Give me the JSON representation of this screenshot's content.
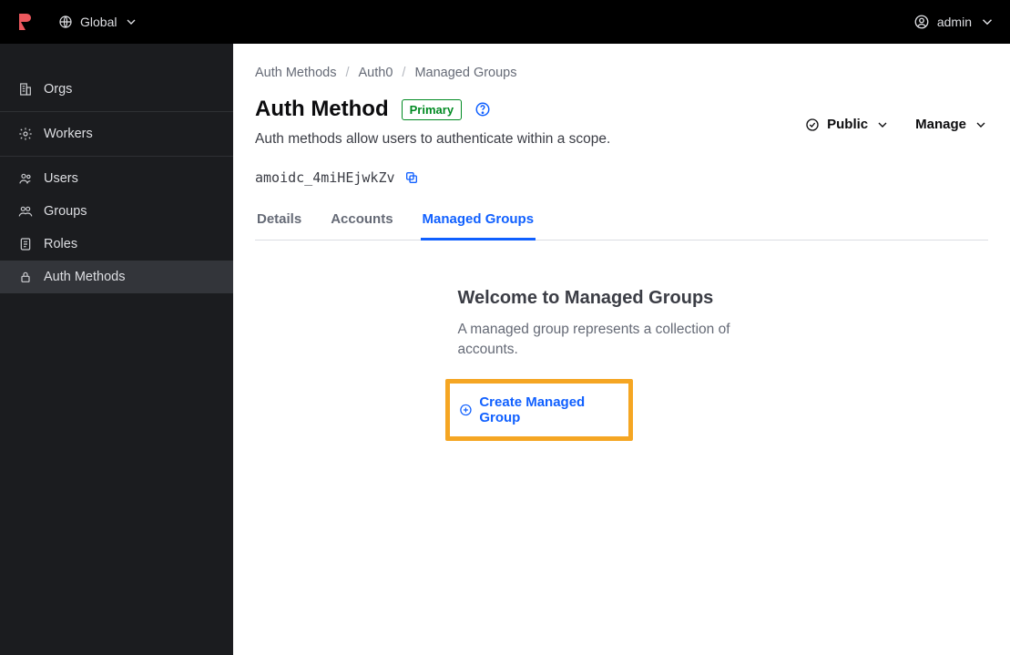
{
  "topbar": {
    "scope_label": "Global",
    "user_label": "admin"
  },
  "sidebar": {
    "items": [
      {
        "label": "Orgs",
        "icon": "org-icon",
        "active": false
      },
      {
        "label": "Workers",
        "icon": "gear-icon",
        "active": false
      },
      {
        "label": "Users",
        "icon": "users-icon",
        "active": false
      },
      {
        "label": "Groups",
        "icon": "groups-icon",
        "active": false
      },
      {
        "label": "Roles",
        "icon": "roles-icon",
        "active": false
      },
      {
        "label": "Auth Methods",
        "icon": "lock-icon",
        "active": true
      }
    ]
  },
  "breadcrumb": {
    "items": [
      "Auth Methods",
      "Auth0",
      "Managed Groups"
    ]
  },
  "page": {
    "title": "Auth Method",
    "badge": "Primary",
    "description": "Auth methods allow users to authenticate within a scope.",
    "resource_id": "amoidc_4miHEjwkZv"
  },
  "actions": {
    "visibility_label": "Public",
    "manage_label": "Manage"
  },
  "tabs": {
    "items": [
      "Details",
      "Accounts",
      "Managed Groups"
    ],
    "active_index": 2
  },
  "empty": {
    "heading": "Welcome to Managed Groups",
    "body": "A managed group represents a collection of accounts.",
    "cta_label": "Create Managed Group"
  }
}
